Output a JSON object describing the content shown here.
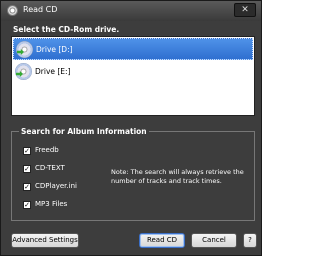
{
  "window": {
    "title": "Read CD",
    "close_glyph": "✕"
  },
  "drives": {
    "section_label": "Select the CD-Rom drive.",
    "items": [
      {
        "label": "Drive [D:]",
        "selected": true,
        "icon": "cd-drive-icon"
      },
      {
        "label": "Drive [E:]",
        "selected": false,
        "icon": "cd-drive-icon"
      }
    ]
  },
  "search": {
    "group_title": "Search for Album Information",
    "options": [
      {
        "label": "Freedb",
        "checked": true
      },
      {
        "label": "CD-TEXT",
        "checked": true
      },
      {
        "label": "CDPlayer.ini",
        "checked": true
      },
      {
        "label": "MP3 Files",
        "checked": true
      }
    ],
    "check_glyph": "✓",
    "note": "Note: The search will always retrieve the number of tracks and track times."
  },
  "buttons": {
    "advanced": "Advanced Settings",
    "read_cd": "Read CD",
    "cancel": "Cancel",
    "help": "?"
  },
  "colors": {
    "window_bg": "#3d3d3d",
    "selection": "#2f6fd0"
  }
}
